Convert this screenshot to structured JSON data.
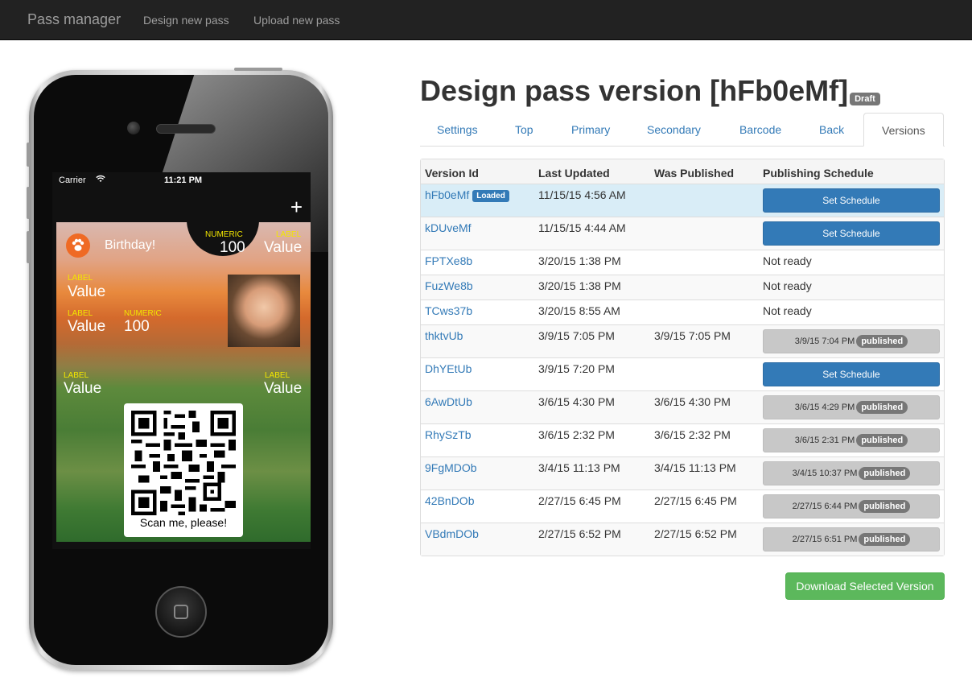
{
  "navbar": {
    "brand": "Pass manager",
    "links": [
      "Design new pass",
      "Upload new pass"
    ]
  },
  "phone": {
    "carrier": "Carrier",
    "time": "11:21 PM",
    "plus": "+",
    "pass": {
      "title": "Birthday!",
      "header_label": "NUMERIC",
      "header_value": "100",
      "header_label2": "LABEL",
      "header_value2": "Value",
      "primary_label": "LABEL",
      "primary_value": "Value",
      "sec_label1": "LABEL",
      "sec_value1": "Value",
      "sec_label2": "NUMERIC",
      "sec_value2": "100",
      "aux_label1": "LABEL",
      "aux_value1": "Value",
      "aux_label2": "LABEL",
      "aux_value2": "Value",
      "barcode_text": "Scan me, please!"
    }
  },
  "page": {
    "title": "Design pass version [hFb0eMf]",
    "badge": "Draft"
  },
  "tabs": [
    "Settings",
    "Top",
    "Primary",
    "Secondary",
    "Barcode",
    "Back",
    "Versions"
  ],
  "active_tab": "Versions",
  "table": {
    "headers": [
      "Version Id",
      "Last Updated",
      "Was Published",
      "Publishing Schedule"
    ],
    "rows": [
      {
        "id": "hFb0eMf",
        "loaded": "Loaded",
        "updated": "11/15/15 4:56 AM",
        "published": "",
        "schedule_type": "button",
        "schedule": "Set Schedule"
      },
      {
        "id": "kDUveMf",
        "updated": "11/15/15 4:44 AM",
        "published": "",
        "schedule_type": "button",
        "schedule": "Set Schedule"
      },
      {
        "id": "FPTXe8b",
        "updated": "3/20/15 1:38 PM",
        "published": "",
        "schedule_type": "text",
        "schedule": "Not ready"
      },
      {
        "id": "FuzWe8b",
        "updated": "3/20/15 1:38 PM",
        "published": "",
        "schedule_type": "text",
        "schedule": "Not ready"
      },
      {
        "id": "TCws37b",
        "updated": "3/20/15 8:55 AM",
        "published": "",
        "schedule_type": "text",
        "schedule": "Not ready"
      },
      {
        "id": "thktvUb",
        "updated": "3/9/15 7:05 PM",
        "published": "3/9/15 7:05 PM",
        "schedule_type": "published",
        "schedule": "3/9/15 7:04 PM",
        "pub_badge": "published"
      },
      {
        "id": "DhYEtUb",
        "updated": "3/9/15 7:20 PM",
        "published": "",
        "schedule_type": "button",
        "schedule": "Set Schedule"
      },
      {
        "id": "6AwDtUb",
        "updated": "3/6/15 4:30 PM",
        "published": "3/6/15 4:30 PM",
        "schedule_type": "published",
        "schedule": "3/6/15 4:29 PM",
        "pub_badge": "published"
      },
      {
        "id": "RhySzTb",
        "updated": "3/6/15 2:32 PM",
        "published": "3/6/15 2:32 PM",
        "schedule_type": "published",
        "schedule": "3/6/15 2:31 PM",
        "pub_badge": "published"
      },
      {
        "id": "9FgMDOb",
        "updated": "3/4/15 11:13 PM",
        "published": "3/4/15 11:13 PM",
        "schedule_type": "published",
        "schedule": "3/4/15 10:37 PM",
        "pub_badge": "published"
      },
      {
        "id": "42BnDOb",
        "updated": "2/27/15 6:45 PM",
        "published": "2/27/15 6:45 PM",
        "schedule_type": "published",
        "schedule": "2/27/15 6:44 PM",
        "pub_badge": "published"
      },
      {
        "id": "VBdmDOb",
        "updated": "2/27/15 6:52 PM",
        "published": "2/27/15 6:52 PM",
        "schedule_type": "published",
        "schedule": "2/27/15 6:51 PM",
        "pub_badge": "published"
      }
    ]
  },
  "download_button": "Download Selected Version",
  "colors": {
    "navbar_bg": "#222222",
    "link": "#337ab7",
    "primary": "#337ab7",
    "success": "#5cb85c",
    "loaded_row": "#d9edf7",
    "badge_gray": "#777777"
  }
}
